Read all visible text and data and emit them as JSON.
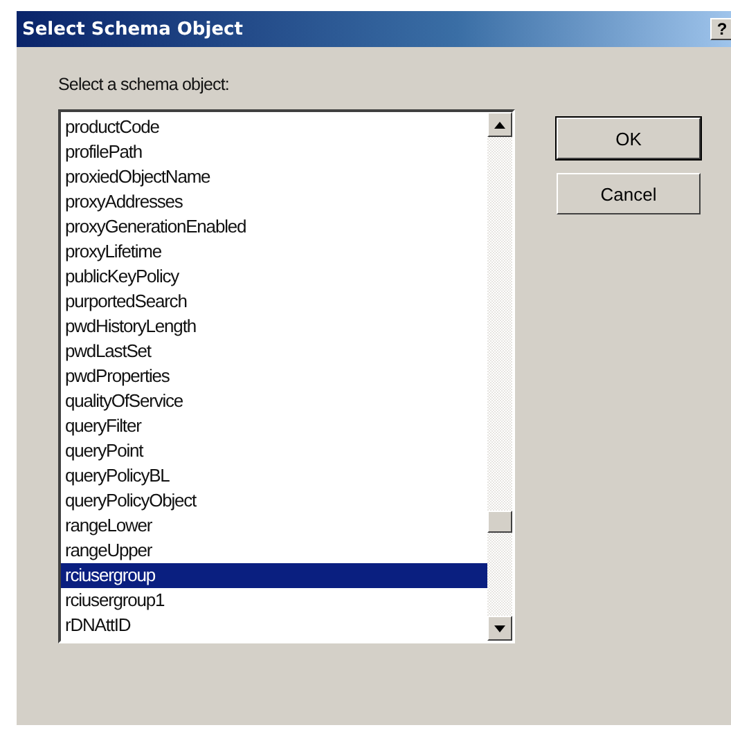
{
  "window": {
    "title": "Select Schema Object",
    "help_button": "?"
  },
  "prompt": "Select a schema object:",
  "list": {
    "items": [
      {
        "label": "productCode",
        "selected": false
      },
      {
        "label": "profilePath",
        "selected": false
      },
      {
        "label": "proxiedObjectName",
        "selected": false
      },
      {
        "label": "proxyAddresses",
        "selected": false
      },
      {
        "label": "proxyGenerationEnabled",
        "selected": false
      },
      {
        "label": "proxyLifetime",
        "selected": false
      },
      {
        "label": "publicKeyPolicy",
        "selected": false
      },
      {
        "label": "purportedSearch",
        "selected": false
      },
      {
        "label": "pwdHistoryLength",
        "selected": false
      },
      {
        "label": "pwdLastSet",
        "selected": false
      },
      {
        "label": "pwdProperties",
        "selected": false
      },
      {
        "label": "qualityOfService",
        "selected": false
      },
      {
        "label": "queryFilter",
        "selected": false
      },
      {
        "label": "queryPoint",
        "selected": false
      },
      {
        "label": "queryPolicyBL",
        "selected": false
      },
      {
        "label": "queryPolicyObject",
        "selected": false
      },
      {
        "label": "rangeLower",
        "selected": false
      },
      {
        "label": "rangeUpper",
        "selected": false
      },
      {
        "label": "rciusergroup",
        "selected": true
      },
      {
        "label": "rciusergroup1",
        "selected": false
      },
      {
        "label": "rDNAttID",
        "selected": false
      }
    ]
  },
  "buttons": [
    "OK",
    "Cancel"
  ]
}
